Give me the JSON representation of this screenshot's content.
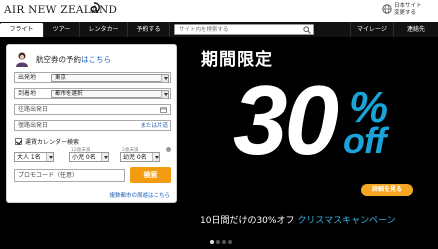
{
  "header": {
    "brand": "AIR NEW ZEALAND",
    "lang_line1": "日本サイト",
    "lang_line2": "変更する"
  },
  "nav": {
    "items": [
      "フライト",
      "ツアー",
      "レンタカー",
      "予約する",
      "マイレージ",
      "連絡先"
    ],
    "search_placeholder": "サイト内を検索する"
  },
  "booking": {
    "title_prefix": "航空券の予約",
    "title_link": "はこちら",
    "from_label": "出発地",
    "from_value": "東京",
    "to_label": "到着地",
    "to_value": "都市を選択",
    "depart_placeholder": "往路出発日",
    "return_placeholder": "復路出発日",
    "oneway_link": "または片道",
    "calendar_label": "運賃カレンダー検索",
    "calendar_checked": true,
    "child_age_note": "12歳未満",
    "infant_age_note": "2歳未満",
    "adults": "大人 1名",
    "children": "小児 0名",
    "infants": "幼児 0名",
    "promo_placeholder": "プロモコード（任意）",
    "search_button": "検索",
    "multi_city_link": "複数都市の周遊はこちら"
  },
  "promo": {
    "headline": "期間限定",
    "big_number": "30",
    "percent": "%",
    "off": "off",
    "details_button": "詳細を見る",
    "line_prefix": "10日間だけの30%オフ",
    "line_highlight": "クリスマスキャンペーン",
    "slide_count": 4,
    "active_slide": 1
  },
  "colors": {
    "accent_orange": "#f39c12",
    "accent_blue": "#1aa3d9",
    "nav_bg": "#111111",
    "promo_bg": "#000000",
    "link": "#1a5fb4"
  }
}
